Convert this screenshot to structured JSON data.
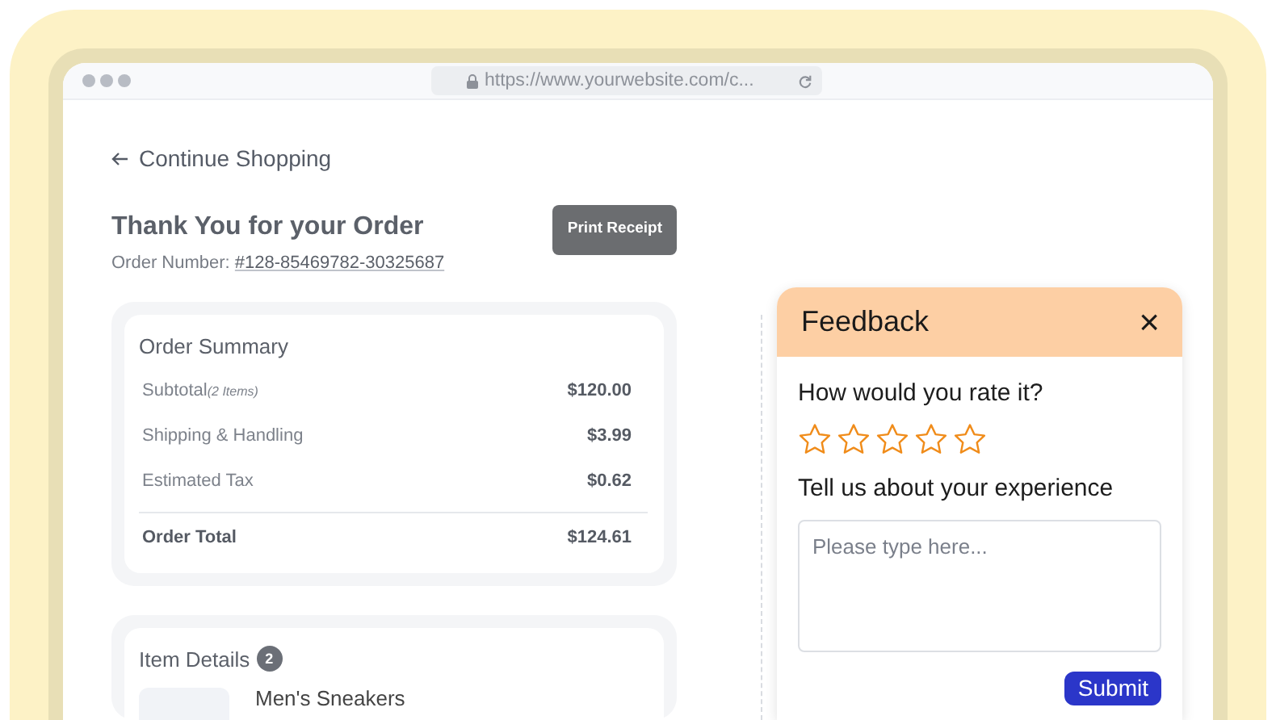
{
  "browser": {
    "url": "https://www.yourwebsite.com/c..."
  },
  "page": {
    "back_link": "Continue Shopping",
    "title": "Thank You for your Order",
    "order_number_label": "Order Number:",
    "order_number": "#128-85469782-30325687",
    "print_button": "Print Receipt"
  },
  "order_summary": {
    "title": "Order Summary",
    "rows": [
      {
        "label": "Subtotal",
        "note": "(2 Items)",
        "value": "$120.00"
      },
      {
        "label": "Shipping & Handling",
        "value": "$3.99"
      },
      {
        "label": "Estimated Tax",
        "value": "$0.62"
      }
    ],
    "total": {
      "label": "Order Total",
      "value": "$124.61"
    }
  },
  "item_details": {
    "title": "Item Details",
    "count": "2",
    "items": [
      {
        "name": "Men's Sneakers"
      }
    ]
  },
  "feedback": {
    "title": "Feedback",
    "close": "×",
    "question": "How would you rate it?",
    "stars": 0,
    "experience_label": "Tell us about your experience",
    "placeholder": "Please type here...",
    "submit": "Submit"
  }
}
